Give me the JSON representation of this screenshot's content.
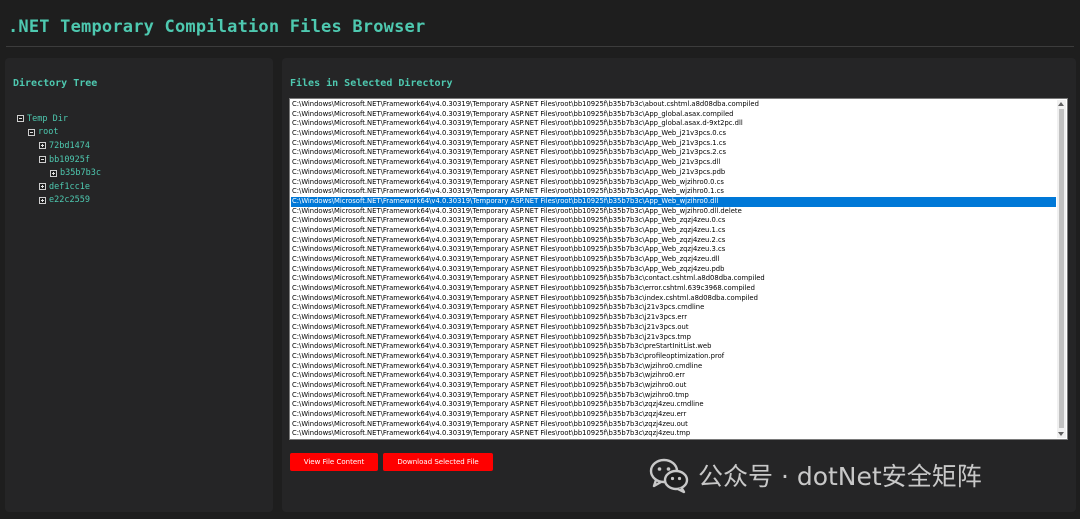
{
  "page": {
    "title": ".NET Temporary Compilation Files Browser"
  },
  "tree_panel": {
    "heading": "Directory Tree",
    "nodes": [
      {
        "label": "Temp Dir",
        "level": 0,
        "expander": "minus"
      },
      {
        "label": "root",
        "level": 1,
        "expander": "minus"
      },
      {
        "label": "72bd1474",
        "level": 2,
        "expander": "plus"
      },
      {
        "label": "bb10925f",
        "level": 2,
        "expander": "minus"
      },
      {
        "label": "b35b7b3c",
        "level": 3,
        "expander": "plus"
      },
      {
        "label": "def1cc1e",
        "level": 2,
        "expander": "plus"
      },
      {
        "label": "e22c2559",
        "level": 2,
        "expander": "plus"
      }
    ]
  },
  "files_panel": {
    "heading": "Files in Selected Directory",
    "selected_index": 10,
    "files": [
      "C:\\Windows\\Microsoft.NET\\Framework64\\v4.0.30319\\Temporary ASP.NET Files\\root\\bb10925f\\b35b7b3c\\about.cshtml.a8d08dba.compiled",
      "C:\\Windows\\Microsoft.NET\\Framework64\\v4.0.30319\\Temporary ASP.NET Files\\root\\bb10925f\\b35b7b3c\\App_global.asax.compiled",
      "C:\\Windows\\Microsoft.NET\\Framework64\\v4.0.30319\\Temporary ASP.NET Files\\root\\bb10925f\\b35b7b3c\\App_global.asax.d-9xt2pc.dll",
      "C:\\Windows\\Microsoft.NET\\Framework64\\v4.0.30319\\Temporary ASP.NET Files\\root\\bb10925f\\b35b7b3c\\App_Web_j21v3pcs.0.cs",
      "C:\\Windows\\Microsoft.NET\\Framework64\\v4.0.30319\\Temporary ASP.NET Files\\root\\bb10925f\\b35b7b3c\\App_Web_j21v3pcs.1.cs",
      "C:\\Windows\\Microsoft.NET\\Framework64\\v4.0.30319\\Temporary ASP.NET Files\\root\\bb10925f\\b35b7b3c\\App_Web_j21v3pcs.2.cs",
      "C:\\Windows\\Microsoft.NET\\Framework64\\v4.0.30319\\Temporary ASP.NET Files\\root\\bb10925f\\b35b7b3c\\App_Web_j21v3pcs.dll",
      "C:\\Windows\\Microsoft.NET\\Framework64\\v4.0.30319\\Temporary ASP.NET Files\\root\\bb10925f\\b35b7b3c\\App_Web_j21v3pcs.pdb",
      "C:\\Windows\\Microsoft.NET\\Framework64\\v4.0.30319\\Temporary ASP.NET Files\\root\\bb10925f\\b35b7b3c\\App_Web_wjzihro0.0.cs",
      "C:\\Windows\\Microsoft.NET\\Framework64\\v4.0.30319\\Temporary ASP.NET Files\\root\\bb10925f\\b35b7b3c\\App_Web_wjzihro0.1.cs",
      "C:\\Windows\\Microsoft.NET\\Framework64\\v4.0.30319\\Temporary ASP.NET Files\\root\\bb10925f\\b35b7b3c\\App_Web_wjzihro0.dll",
      "C:\\Windows\\Microsoft.NET\\Framework64\\v4.0.30319\\Temporary ASP.NET Files\\root\\bb10925f\\b35b7b3c\\App_Web_wjzihro0.dll.delete",
      "C:\\Windows\\Microsoft.NET\\Framework64\\v4.0.30319\\Temporary ASP.NET Files\\root\\bb10925f\\b35b7b3c\\App_Web_zqzj4zeu.0.cs",
      "C:\\Windows\\Microsoft.NET\\Framework64\\v4.0.30319\\Temporary ASP.NET Files\\root\\bb10925f\\b35b7b3c\\App_Web_zqzj4zeu.1.cs",
      "C:\\Windows\\Microsoft.NET\\Framework64\\v4.0.30319\\Temporary ASP.NET Files\\root\\bb10925f\\b35b7b3c\\App_Web_zqzj4zeu.2.cs",
      "C:\\Windows\\Microsoft.NET\\Framework64\\v4.0.30319\\Temporary ASP.NET Files\\root\\bb10925f\\b35b7b3c\\App_Web_zqzj4zeu.3.cs",
      "C:\\Windows\\Microsoft.NET\\Framework64\\v4.0.30319\\Temporary ASP.NET Files\\root\\bb10925f\\b35b7b3c\\App_Web_zqzj4zeu.dll",
      "C:\\Windows\\Microsoft.NET\\Framework64\\v4.0.30319\\Temporary ASP.NET Files\\root\\bb10925f\\b35b7b3c\\App_Web_zqzj4zeu.pdb",
      "C:\\Windows\\Microsoft.NET\\Framework64\\v4.0.30319\\Temporary ASP.NET Files\\root\\bb10925f\\b35b7b3c\\contact.cshtml.a8d08dba.compiled",
      "C:\\Windows\\Microsoft.NET\\Framework64\\v4.0.30319\\Temporary ASP.NET Files\\root\\bb10925f\\b35b7b3c\\error.cshtml.639c3968.compiled",
      "C:\\Windows\\Microsoft.NET\\Framework64\\v4.0.30319\\Temporary ASP.NET Files\\root\\bb10925f\\b35b7b3c\\index.cshtml.a8d08dba.compiled",
      "C:\\Windows\\Microsoft.NET\\Framework64\\v4.0.30319\\Temporary ASP.NET Files\\root\\bb10925f\\b35b7b3c\\j21v3pcs.cmdline",
      "C:\\Windows\\Microsoft.NET\\Framework64\\v4.0.30319\\Temporary ASP.NET Files\\root\\bb10925f\\b35b7b3c\\j21v3pcs.err",
      "C:\\Windows\\Microsoft.NET\\Framework64\\v4.0.30319\\Temporary ASP.NET Files\\root\\bb10925f\\b35b7b3c\\j21v3pcs.out",
      "C:\\Windows\\Microsoft.NET\\Framework64\\v4.0.30319\\Temporary ASP.NET Files\\root\\bb10925f\\b35b7b3c\\j21v3pcs.tmp",
      "C:\\Windows\\Microsoft.NET\\Framework64\\v4.0.30319\\Temporary ASP.NET Files\\root\\bb10925f\\b35b7b3c\\preStartInitList.web",
      "C:\\Windows\\Microsoft.NET\\Framework64\\v4.0.30319\\Temporary ASP.NET Files\\root\\bb10925f\\b35b7b3c\\profileoptimization.prof",
      "C:\\Windows\\Microsoft.NET\\Framework64\\v4.0.30319\\Temporary ASP.NET Files\\root\\bb10925f\\b35b7b3c\\wjzihro0.cmdline",
      "C:\\Windows\\Microsoft.NET\\Framework64\\v4.0.30319\\Temporary ASP.NET Files\\root\\bb10925f\\b35b7b3c\\wjzihro0.err",
      "C:\\Windows\\Microsoft.NET\\Framework64\\v4.0.30319\\Temporary ASP.NET Files\\root\\bb10925f\\b35b7b3c\\wjzihro0.out",
      "C:\\Windows\\Microsoft.NET\\Framework64\\v4.0.30319\\Temporary ASP.NET Files\\root\\bb10925f\\b35b7b3c\\wjzihro0.tmp",
      "C:\\Windows\\Microsoft.NET\\Framework64\\v4.0.30319\\Temporary ASP.NET Files\\root\\bb10925f\\b35b7b3c\\zqzj4zeu.cmdline",
      "C:\\Windows\\Microsoft.NET\\Framework64\\v4.0.30319\\Temporary ASP.NET Files\\root\\bb10925f\\b35b7b3c\\zqzj4zeu.err",
      "C:\\Windows\\Microsoft.NET\\Framework64\\v4.0.30319\\Temporary ASP.NET Files\\root\\bb10925f\\b35b7b3c\\zqzj4zeu.out",
      "C:\\Windows\\Microsoft.NET\\Framework64\\v4.0.30319\\Temporary ASP.NET Files\\root\\bb10925f\\b35b7b3c\\zqzj4zeu.tmp"
    ],
    "buttons": {
      "view_label": "View File Content",
      "download_label": "Download Selected File"
    }
  },
  "watermark": {
    "text": "公众号 · dotNet安全矩阵",
    "icon": "wechat-logo-icon"
  },
  "colors": {
    "accent": "#4ec9b0",
    "background": "#1e1e1e",
    "panel": "#252526",
    "button": "#ff0000",
    "selection": "#0078d7"
  }
}
